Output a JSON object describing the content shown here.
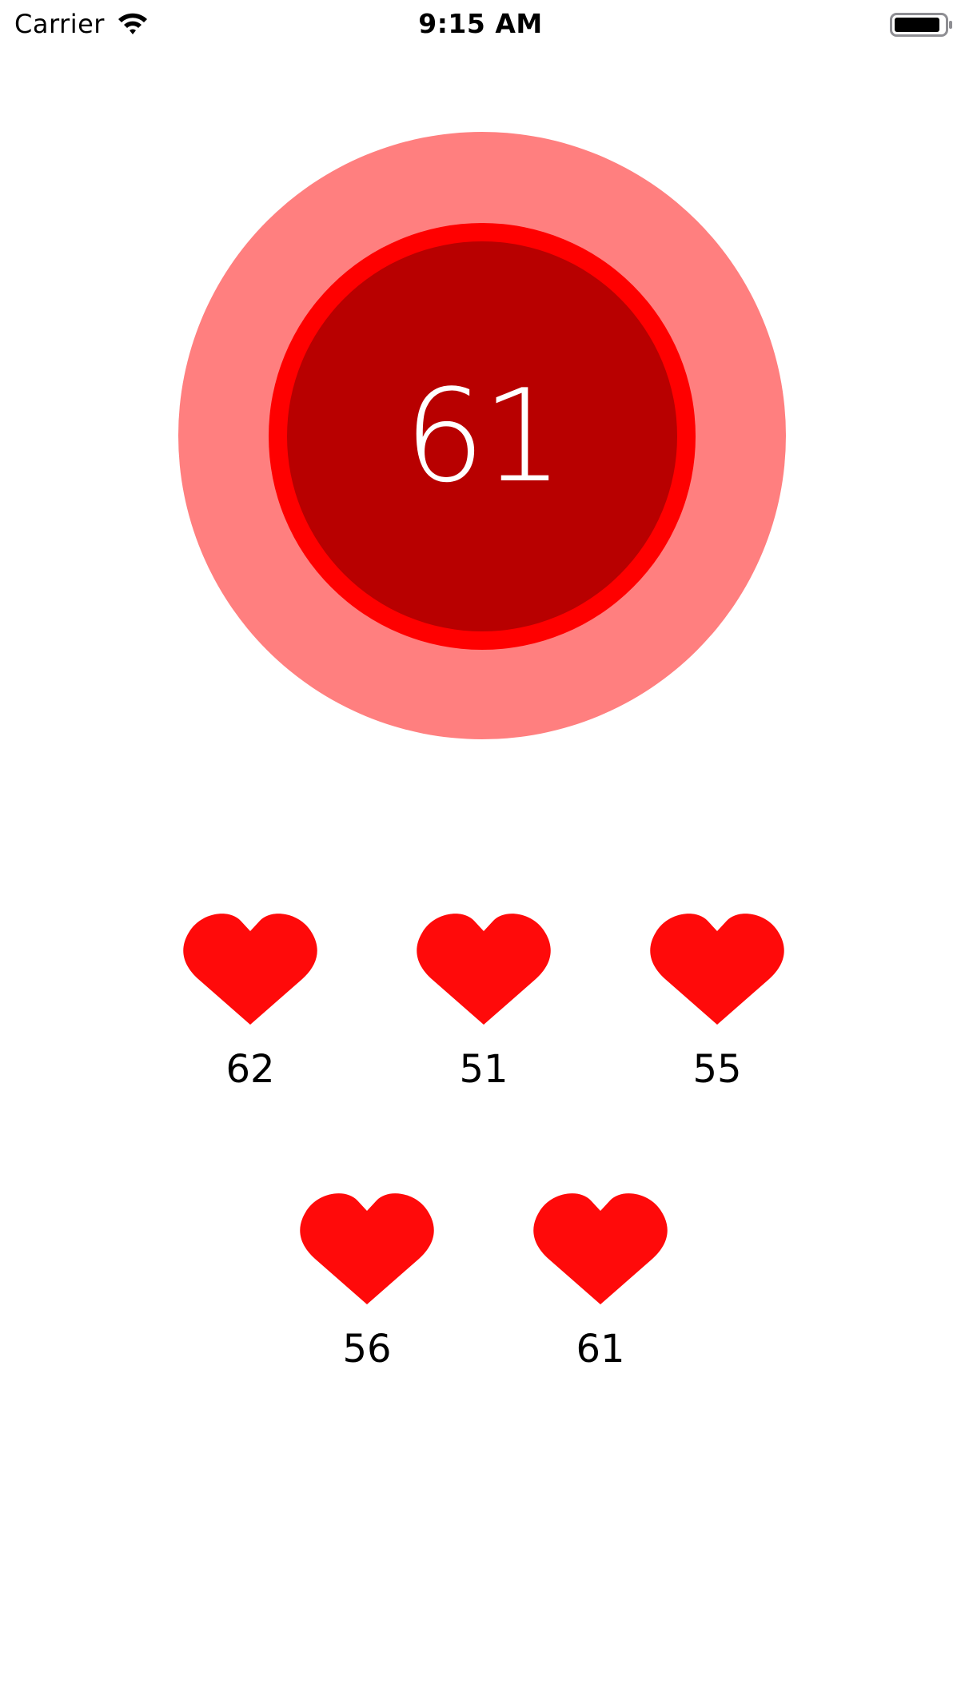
{
  "status_bar": {
    "carrier": "Carrier",
    "time": "9:15 AM",
    "wifi_icon": "wifi-icon",
    "battery_icon": "battery-icon"
  },
  "gauge": {
    "value": "61",
    "colors": {
      "outer": "#FF7F7F",
      "ring": "#FF0000",
      "inner": "#B80000",
      "text": "#FFFFFF"
    }
  },
  "readings": [
    {
      "value": "62",
      "icon": "heart-icon"
    },
    {
      "value": "51",
      "icon": "heart-icon"
    },
    {
      "value": "55",
      "icon": "heart-icon"
    },
    {
      "value": "56",
      "icon": "heart-icon"
    },
    {
      "value": "61",
      "icon": "heart-icon"
    }
  ],
  "colors": {
    "heart": "#FF0A0A",
    "background": "#FFFFFF"
  }
}
